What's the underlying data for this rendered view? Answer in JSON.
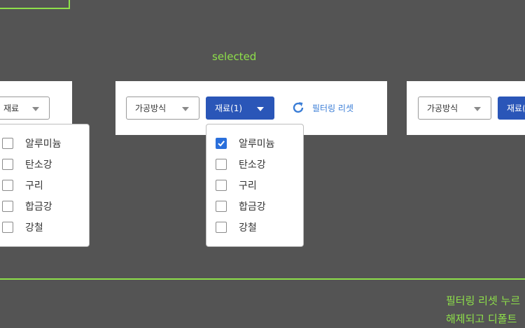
{
  "section_label": "selected",
  "left_panel": {
    "material_dropdown": {
      "label": "재료"
    },
    "options": [
      {
        "label": "알루미늄",
        "checked": false
      },
      {
        "label": "탄소강",
        "checked": false
      },
      {
        "label": "구리",
        "checked": false
      },
      {
        "label": "합금강",
        "checked": false
      },
      {
        "label": "강철",
        "checked": false
      }
    ]
  },
  "center_panel": {
    "process_dropdown": {
      "label": "가공방식"
    },
    "material_dropdown": {
      "label": "재료(1)"
    },
    "reset_label": "필터링 리셋",
    "options": [
      {
        "label": "알루미늄",
        "checked": true
      },
      {
        "label": "탄소강",
        "checked": false
      },
      {
        "label": "구리",
        "checked": false
      },
      {
        "label": "합금강",
        "checked": false
      },
      {
        "label": "강철",
        "checked": false
      }
    ]
  },
  "right_panel": {
    "process_dropdown": {
      "label": "가공방식"
    },
    "material_dropdown": {
      "label": "재료("
    }
  },
  "note": {
    "line1": "필터링 리셋 누르",
    "line2": "해제되고 디폴트"
  },
  "colors": {
    "background": "#545454",
    "accent_green": "#8ee04a",
    "primary_blue": "#2a56b8",
    "link_blue": "#3a7dd6"
  }
}
